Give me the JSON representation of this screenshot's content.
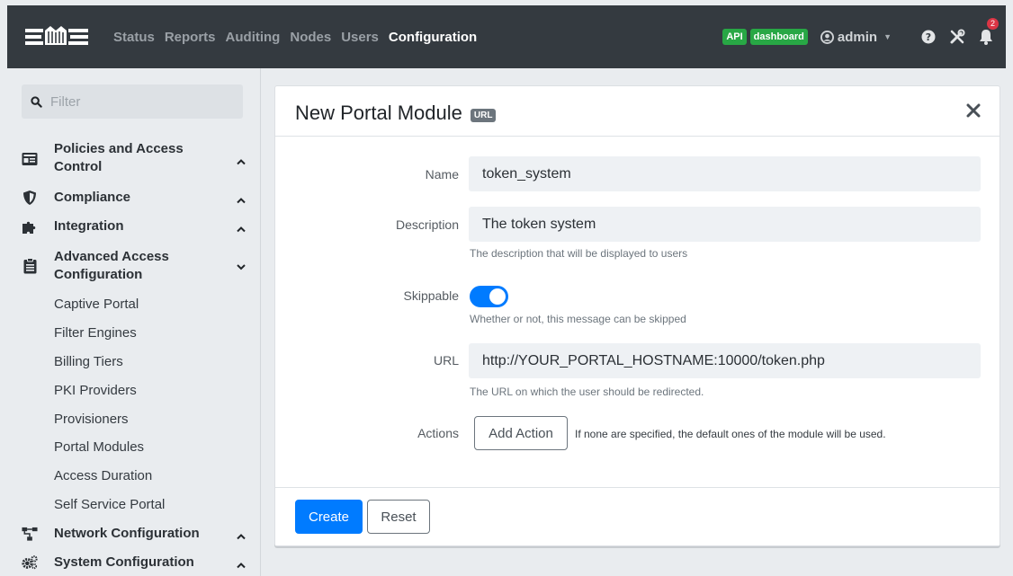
{
  "navbar": {
    "links": [
      "Status",
      "Reports",
      "Auditing",
      "Nodes",
      "Users",
      "Configuration"
    ],
    "active_link": "Configuration",
    "api_badge": "API",
    "dashboard_badge": "dashboard",
    "user": "admin",
    "notification_count": "2",
    "icons": [
      "logo-icon",
      "user-circle-icon",
      "help-icon",
      "tools-icon",
      "bell-icon"
    ]
  },
  "sidebar": {
    "filter_placeholder": "Filter",
    "groups": [
      {
        "label": "Policies and Access Control",
        "icon": "id-card-icon",
        "expanded": false
      },
      {
        "label": "Compliance",
        "icon": "shield-icon",
        "expanded": false
      },
      {
        "label": "Integration",
        "icon": "puzzle-icon",
        "expanded": false
      },
      {
        "label": "Advanced Access Configuration",
        "icon": "clipboard-icon",
        "expanded": true
      },
      {
        "label": "Network Configuration",
        "icon": "network-icon",
        "expanded": false
      },
      {
        "label": "System Configuration",
        "icon": "cogs-icon",
        "expanded": false
      }
    ],
    "sub_items": [
      "Captive Portal",
      "Filter Engines",
      "Billing Tiers",
      "PKI Providers",
      "Provisioners",
      "Portal Modules",
      "Access Duration",
      "Self Service Portal"
    ]
  },
  "card": {
    "title": "New Portal Module",
    "type_badge": "URL",
    "fields": {
      "name": {
        "label": "Name",
        "value": "token_system"
      },
      "description": {
        "label": "Description",
        "value": "The token system",
        "help": "The description that will be displayed to users"
      },
      "skippable": {
        "label": "Skippable",
        "enabled": true,
        "help": "Whether or not, this message can be skipped"
      },
      "url": {
        "label": "URL",
        "value": "http://YOUR_PORTAL_HOSTNAME:10000/token.php",
        "help": "The URL on which the user should be redirected."
      },
      "actions": {
        "label": "Actions",
        "button": "Add Action",
        "help": "If none are specified, the default ones of the module will be used."
      }
    },
    "footer": {
      "create": "Create",
      "reset": "Reset"
    }
  },
  "colors": {
    "primary": "#007bff",
    "navbar": "#343a40",
    "success": "#28a745",
    "danger": "#dc3545"
  }
}
